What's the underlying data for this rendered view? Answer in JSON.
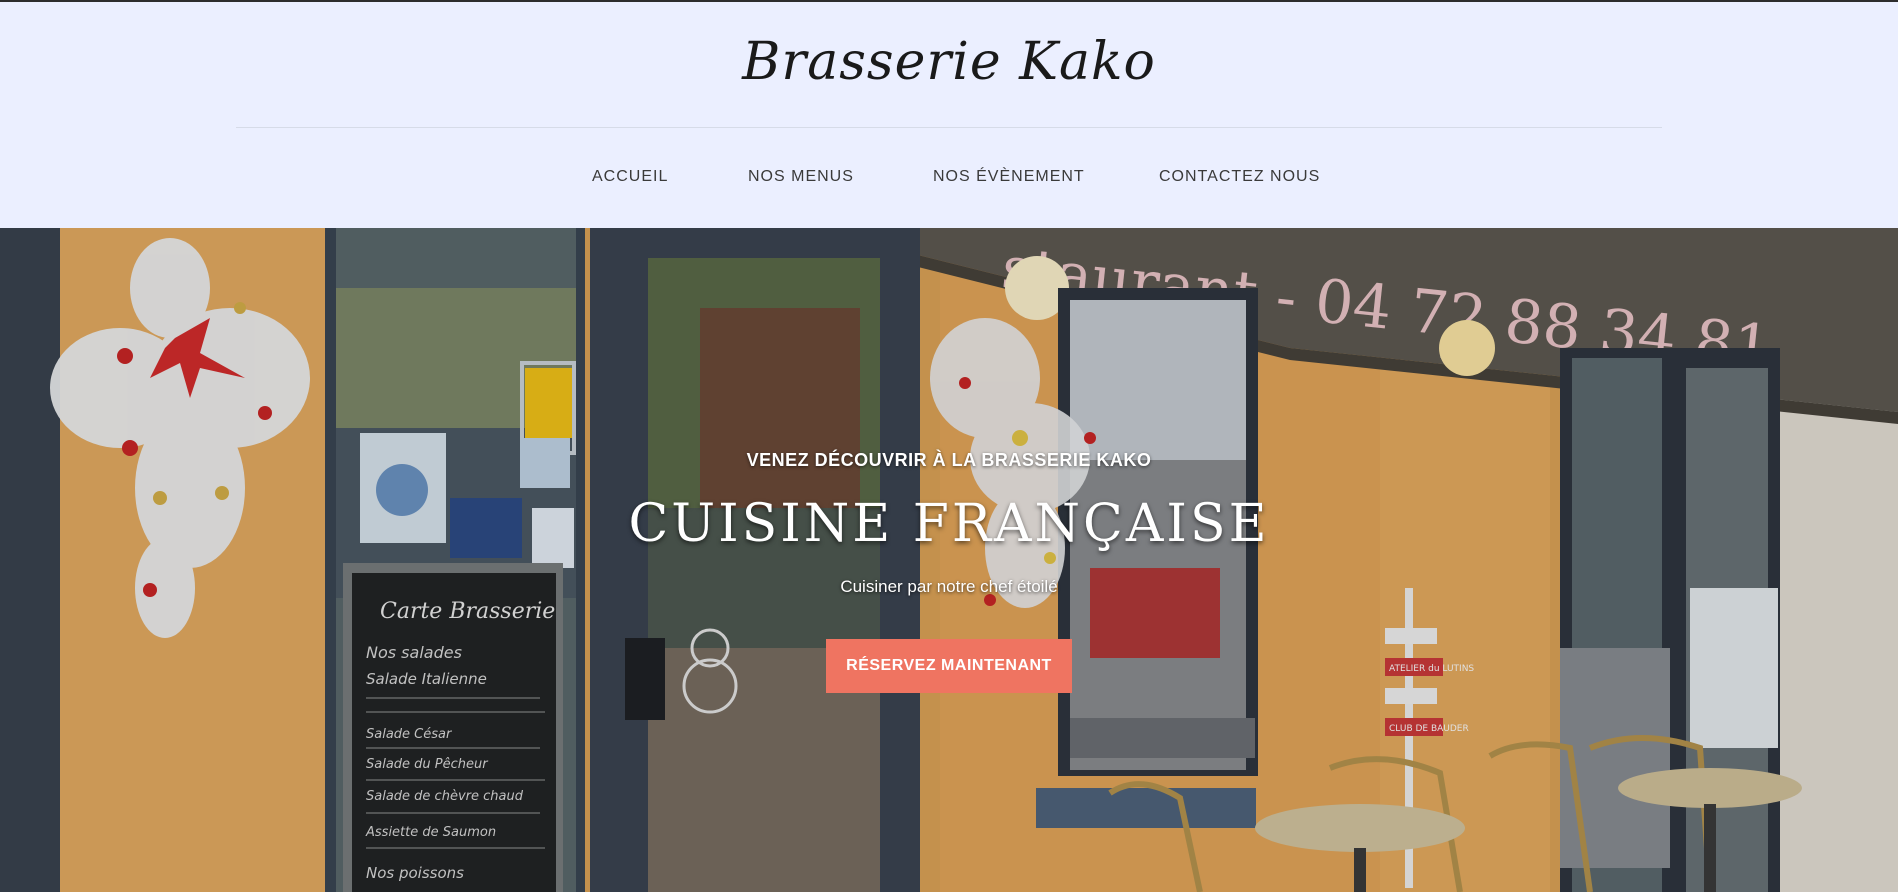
{
  "site": {
    "brand": "Brasserie Kako"
  },
  "nav": {
    "items": [
      {
        "label": "ACCUEIL"
      },
      {
        "label": "NOS MENUS"
      },
      {
        "label": "NOS ÉVÈNEMENT"
      },
      {
        "label": "CONTACTEZ NOUS"
      }
    ]
  },
  "hero": {
    "kicker": "VENEZ DÉCOUVRIR À LA BRASSERIE KAKO",
    "headline": "CUISINE FRANÇAISE",
    "tagline": "Cuisiner par notre chef étoilé",
    "cta_label": "RÉSERVEZ MAINTENANT",
    "awning_text": "staurant - 04 72 88 34 81",
    "chalkboard": {
      "title": "Carte Brasserie",
      "lines": [
        "Nos salades",
        "Salade Italienne",
        "Salade César",
        "Salade du Pêcheur",
        "Salade de chèvre chaud",
        "Assiette de Saumon",
        "Nos poissons"
      ]
    },
    "signs": [
      "ATELIER du LUTINS",
      "CLUB DE BAUDER"
    ]
  },
  "colors": {
    "header_bg": "#ebefff",
    "cta": "#ef7461",
    "wall": "#e3a95c"
  }
}
